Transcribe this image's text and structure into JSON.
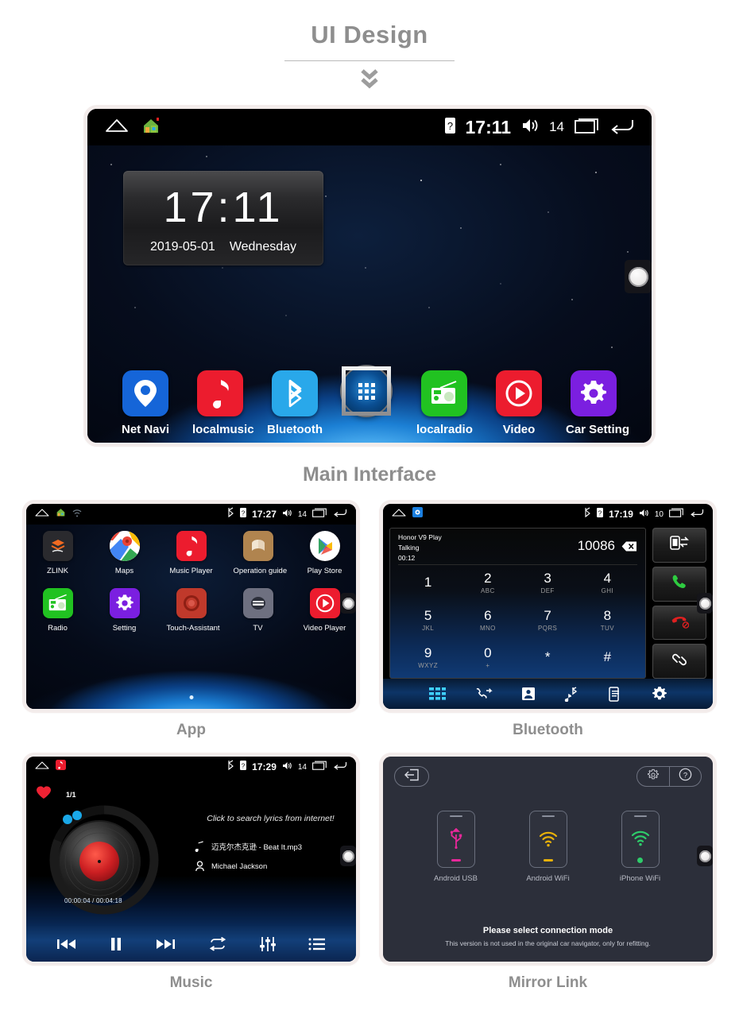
{
  "page": {
    "title": "UI Design",
    "chevron_icon": "double-chevron-down-icon"
  },
  "main_interface": {
    "caption": "Main Interface",
    "statusbar": {
      "home_icon": "home-outline-icon",
      "house_icon": "house-icon",
      "sim_icon": "sim-card-icon",
      "clock": "17:11",
      "volume_icon": "volume-icon",
      "volume_level": "14",
      "recents_icon": "recents-icon",
      "back_icon": "back-arrow-icon"
    },
    "clock_widget": {
      "time": "17:11",
      "date": "2019-05-01",
      "weekday": "Wednesday"
    },
    "dock": [
      {
        "label": "Net Navi",
        "icon": "map-pin-icon",
        "color": "#1565d8"
      },
      {
        "label": "localmusic",
        "icon": "music-note-icon",
        "color": "#ec1c2e"
      },
      {
        "label": "Bluetooth",
        "icon": "bluetooth-icon",
        "color": "#29a8ea"
      },
      {
        "label": "",
        "icon": "app-drawer-icon",
        "color": "#0a4e92"
      },
      {
        "label": "localradio",
        "icon": "radio-icon",
        "color": "#21c221"
      },
      {
        "label": "Video",
        "icon": "play-circle-icon",
        "color": "#ec1c2e"
      },
      {
        "label": "Car Setting",
        "icon": "gear-icon",
        "color": "#7b1fe0"
      }
    ]
  },
  "app_panel": {
    "caption": "App",
    "statusbar": {
      "home_icon": "home-outline-icon",
      "house_icon": "house-icon",
      "wifi_icon": "wifi-icon",
      "bluetooth_icon": "bluetooth-icon",
      "sim_icon": "sim-card-icon",
      "clock": "17:27",
      "volume_icon": "volume-icon",
      "volume_level": "14",
      "recents_icon": "recents-icon",
      "back_icon": "back-arrow-icon"
    },
    "rows": [
      [
        {
          "label": "ZLINK",
          "icon": "zlink-icon",
          "color": "#2a2a2e"
        },
        {
          "label": "Maps",
          "icon": "google-maps-icon",
          "color": "#ffffff"
        },
        {
          "label": "Music Player",
          "icon": "music-note-icon",
          "color": "#ec1c2e"
        },
        {
          "label": "Operation guide",
          "icon": "book-guide-icon",
          "color": "#b0844f"
        },
        {
          "label": "Play Store",
          "icon": "play-store-icon",
          "color": "#ffffff"
        }
      ],
      [
        {
          "label": "Radio",
          "icon": "radio-icon",
          "color": "#21c221"
        },
        {
          "label": "Setting",
          "icon": "gear-icon",
          "color": "#7b1fe0"
        },
        {
          "label": "Touch-Assistant",
          "icon": "touch-circle-icon",
          "color": "#c0392b"
        },
        {
          "label": "TV",
          "icon": "tv-icon",
          "color": "#6e7080"
        },
        {
          "label": "Video Player",
          "icon": "play-circle-icon",
          "color": "#ec1c2e"
        }
      ]
    ]
  },
  "bluetooth_panel": {
    "caption": "Bluetooth",
    "statusbar": {
      "home_icon": "home-outline-icon",
      "app_icon": "bt-app-icon",
      "bluetooth_icon": "bluetooth-icon",
      "sim_icon": "sim-card-icon",
      "clock": "17:19",
      "volume_icon": "volume-icon",
      "volume_level": "10",
      "recents_icon": "recents-icon",
      "back_icon": "back-arrow-icon"
    },
    "call": {
      "device_name": "Honor V9 Play",
      "state": "Talking",
      "duration": "00:12",
      "number": "10086",
      "delete_icon": "backspace-icon"
    },
    "keys": [
      {
        "digit": "1",
        "sub": ""
      },
      {
        "digit": "2",
        "sub": "ABC"
      },
      {
        "digit": "3",
        "sub": "DEF"
      },
      {
        "digit": "4",
        "sub": "GHI"
      },
      {
        "digit": "5",
        "sub": "JKL"
      },
      {
        "digit": "6",
        "sub": "MNO"
      },
      {
        "digit": "7",
        "sub": "PQRS"
      },
      {
        "digit": "8",
        "sub": "TUV"
      },
      {
        "digit": "9",
        "sub": "WXYZ"
      },
      {
        "digit": "0",
        "sub": "+"
      },
      {
        "digit": "*",
        "sub": ""
      },
      {
        "digit": "#",
        "sub": ""
      }
    ],
    "side_buttons": [
      {
        "icon": "transfer-audio-icon",
        "color": "#ffffff"
      },
      {
        "icon": "call-answer-icon",
        "color": "#2ecc40"
      },
      {
        "icon": "call-end-icon",
        "color": "#e02020"
      },
      {
        "icon": "link-icon",
        "color": "#ffffff"
      }
    ],
    "tabs": [
      {
        "icon": "dialpad-icon",
        "active": true
      },
      {
        "icon": "call-log-icon",
        "active": false
      },
      {
        "icon": "contacts-icon",
        "active": false
      },
      {
        "icon": "bt-music-icon",
        "active": false
      },
      {
        "icon": "sync-phone-icon",
        "active": false
      },
      {
        "icon": "gear-icon",
        "active": false
      }
    ],
    "tab_active_color": "#3fd0ff"
  },
  "music_panel": {
    "caption": "Music",
    "statusbar": {
      "home_icon": "home-outline-icon",
      "app_icon": "music-app-icon",
      "bluetooth_icon": "bluetooth-icon",
      "sim_icon": "sim-card-icon",
      "clock": "17:29",
      "volume_icon": "volume-icon",
      "volume_level": "14",
      "recents_icon": "recents-icon",
      "back_icon": "back-arrow-icon"
    },
    "favorite_icon": "heart-icon",
    "track_count": "1/1",
    "lyrics_hint": "Click to search lyrics from internet!",
    "track_title": "迈克尔杰克逊 - Beat It.mp3",
    "artist": "Michael Jackson",
    "time": "00:00:04 / 00:04:18",
    "controls": [
      {
        "icon": "previous-track-icon"
      },
      {
        "icon": "pause-icon"
      },
      {
        "icon": "next-track-icon"
      },
      {
        "icon": "repeat-icon"
      },
      {
        "icon": "equalizer-icon"
      },
      {
        "icon": "playlist-icon"
      }
    ]
  },
  "mirror_link_panel": {
    "caption": "Mirror Link",
    "back_icon": "exit-arrow-icon",
    "gear_icon": "gear-icon",
    "help_icon": "help-circle-icon",
    "modes": [
      {
        "label": "Android USB",
        "icon": "usb-icon",
        "color": "#e8289a"
      },
      {
        "label": "Android WiFi",
        "icon": "wifi-icon",
        "color": "#e8b10a"
      },
      {
        "label": "iPhone WiFi",
        "icon": "wifi-icon",
        "color": "#2ecc6a"
      }
    ],
    "footer_primary": "Please select connection mode",
    "footer_secondary": "This version is not used in the original car navigator, only for refitting."
  }
}
